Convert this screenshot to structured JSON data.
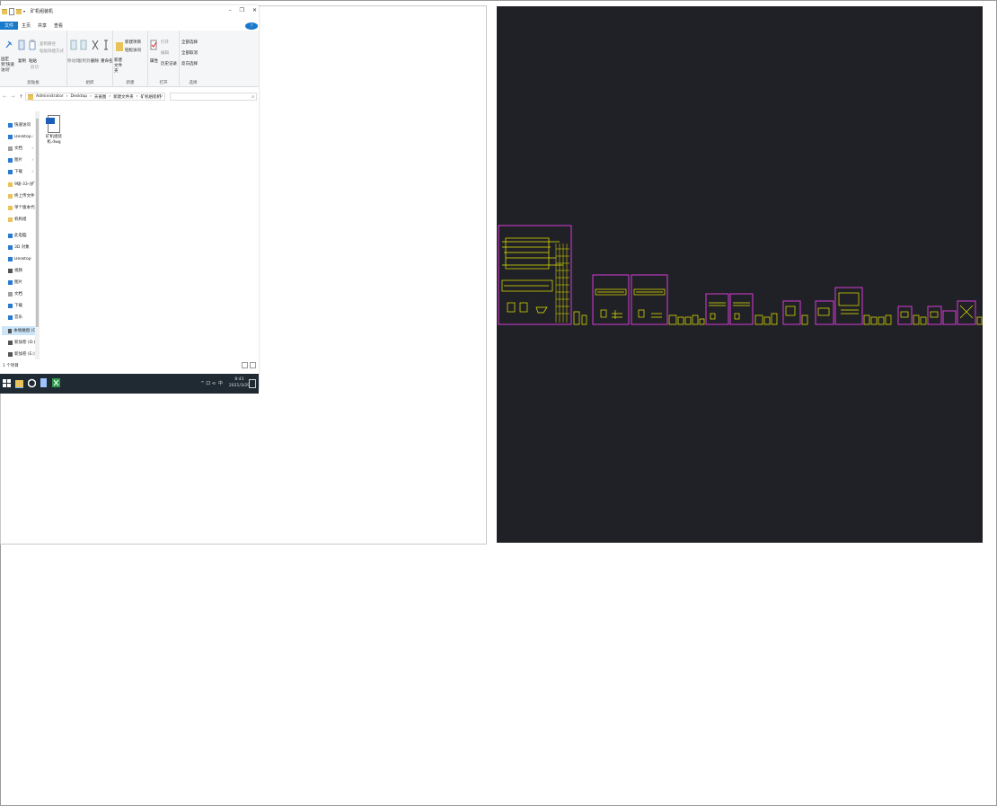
{
  "explorer": {
    "title": "矿机组装机",
    "menu_tabs": [
      "文件",
      "主页",
      "共享",
      "查看"
    ],
    "help": "?",
    "window_controls": [
      "–",
      "❐",
      "✕"
    ],
    "ribbon": {
      "clipboard": {
        "label": "剪贴板",
        "pin_label": "固定到'快速访问'",
        "copy_label": "复制",
        "paste_label": "粘贴",
        "cut_label": "剪切",
        "copy_path_label": "复制路径",
        "paste_shortcut_label": "粘贴快捷方式"
      },
      "organize": {
        "label": "组织",
        "move_label": "移动到",
        "copy_to_label": "复制到",
        "delete_label": "删除",
        "rename_label": "重命名"
      },
      "new": {
        "label": "新建",
        "new_folder_label": "新建文件夹",
        "new_item_label": "新建项目",
        "easy_access_label": "轻松访问"
      },
      "open": {
        "label": "打开",
        "properties_label": "属性",
        "open_label": "打开",
        "edit_label": "编辑",
        "history_label": "历史记录"
      },
      "select": {
        "label": "选择",
        "select_all_label": "全部选择",
        "select_none_label": "全部取消",
        "invert_label": "反向选择"
      }
    },
    "address": {
      "segments": [
        "Administrator",
        "Desktop",
        "天雀图",
        "新建文件夹",
        "矿机组装机"
      ],
      "search_placeholder": ""
    },
    "nav": {
      "items": [
        {
          "label": "快速访问",
          "icon": "star-icon",
          "color": "#2a7ad4"
        },
        {
          "label": "Desktop",
          "icon": "desktop-icon",
          "color": "#2a7ad4"
        },
        {
          "label": "文档",
          "icon": "document-icon",
          "color": "#a0a0a0"
        },
        {
          "label": "图片",
          "icon": "picture-icon",
          "color": "#2a7ad4"
        },
        {
          "label": "下载",
          "icon": "download-icon",
          "color": "#2a7ad4"
        },
        {
          "label": "9级-33-(扩大)",
          "icon": "folder-icon",
          "color": "#e8c35b"
        },
        {
          "label": "终上传文件",
          "icon": "folder-icon",
          "color": "#e8c35b"
        },
        {
          "label": "单个版本代码整",
          "icon": "folder-icon",
          "color": "#e8c35b"
        },
        {
          "label": "机构组",
          "icon": "folder-icon",
          "color": "#e8c35b"
        },
        {
          "label": "此电脑",
          "icon": "computer-icon",
          "color": "#2a7ad4"
        },
        {
          "label": "3D 对象",
          "icon": "cube-icon",
          "color": "#2a7ad4"
        },
        {
          "label": "Desktop",
          "icon": "desktop-icon",
          "color": "#2a7ad4"
        },
        {
          "label": "视频",
          "icon": "video-icon",
          "color": "#555555"
        },
        {
          "label": "图片",
          "icon": "picture-icon",
          "color": "#2a7ad4"
        },
        {
          "label": "文档",
          "icon": "document-icon",
          "color": "#a0a0a0"
        },
        {
          "label": "下载",
          "icon": "download-icon",
          "color": "#2a7ad4"
        },
        {
          "label": "音乐",
          "icon": "music-icon",
          "color": "#2a7ad4"
        },
        {
          "label": "本地磁盘 (C:)",
          "icon": "drive-icon",
          "color": "#555555"
        },
        {
          "label": "新加卷 (D:)",
          "icon": "drive-icon",
          "color": "#555555"
        },
        {
          "label": "新加卷 (E:)",
          "icon": "drive-icon",
          "color": "#555555"
        }
      ],
      "pin_symbol": "✓"
    },
    "files": [
      {
        "name": "矿机组装机.dwg",
        "line1": "矿机组装",
        "line2": "机.dwg"
      }
    ],
    "status": "1 个项目"
  },
  "taskbar": {
    "time": "8:43",
    "date": "2021/3/29",
    "lang": "中",
    "tray_symbols": "^ 口 ⊲"
  },
  "colors": {
    "cad_bg": "#202126",
    "cad_frame": "#d63ad6",
    "cad_line": "#e6e600",
    "accent": "#1979ca",
    "taskbar": "#1f2a33"
  }
}
